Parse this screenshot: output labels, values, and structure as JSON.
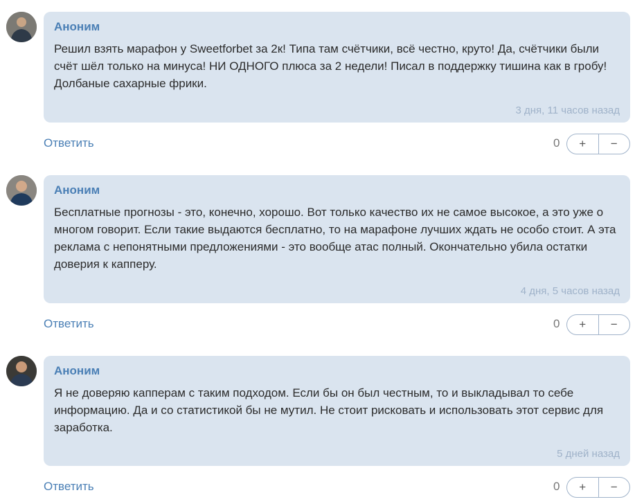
{
  "comments": [
    {
      "author": "Аноним",
      "text": "Решил взять марафон у Sweetforbet за 2к! Типа там счётчики, всё честно, круто! Да, счётчики были счёт шёл только на минуса! НИ ОДНОГО плюса за 2 недели! Писал в поддержку тишина как в гробу! Долбаные сахарные фрики.",
      "time": "3 дня, 11 часов назад",
      "reply_label": "Ответить",
      "votes": "0",
      "plus_label": "+",
      "minus_label": "−"
    },
    {
      "author": "Аноним",
      "text": "Бесплатные прогнозы - это, конечно, хорошо. Вот только качество их не самое высокое, а это уже о многом говорит. Если такие выдаются бесплатно, то на марафоне лучших ждать не особо стоит. А эта реклама с непонятными предложениями - это вообще атас полный. Окончательно убила остатки доверия к капперу.",
      "time": "4 дня, 5 часов назад",
      "reply_label": "Ответить",
      "votes": "0",
      "plus_label": "+",
      "minus_label": "−"
    },
    {
      "author": "Аноним",
      "text": "Я не доверяю капперам с таким подходом. Если бы он был честным, то и выкладывал то себе информацию. Да и со статистикой бы не мутил. Не стоит рисковать и использовать этот сервис для заработка.",
      "time": "5 дней назад",
      "reply_label": "Ответить",
      "votes": "0",
      "plus_label": "+",
      "minus_label": "−"
    }
  ]
}
